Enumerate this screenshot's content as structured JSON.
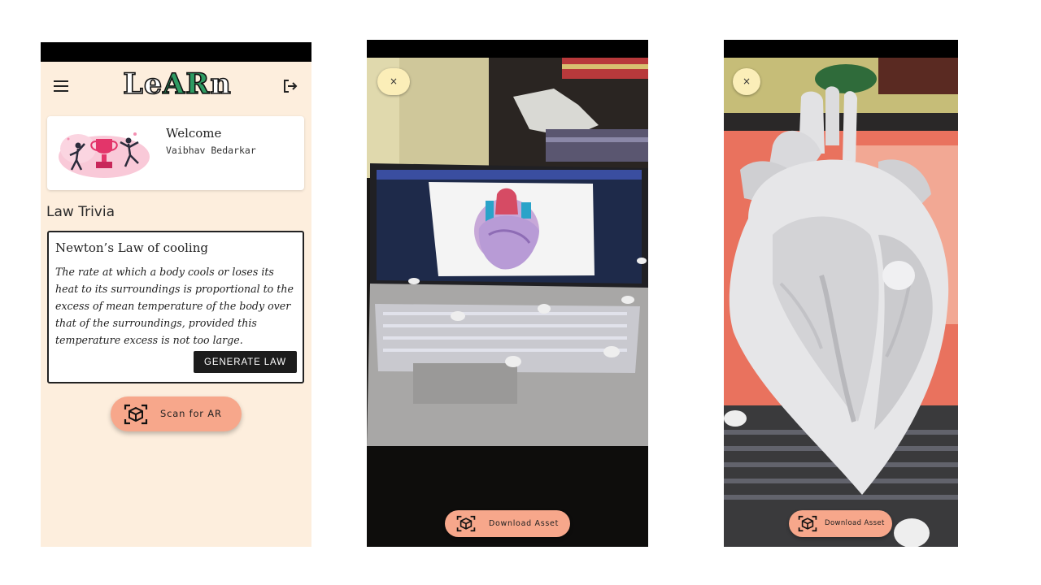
{
  "home": {
    "app_title": "LeARn",
    "logo_part_1": "Le",
    "logo_part_2": "AR",
    "logo_part_3": "n",
    "menu_icon": "hamburger-menu-icon",
    "logout_icon": "logout-icon",
    "welcome": {
      "title": "Welcome",
      "user_name": "Vaibhav Bedarkar",
      "illustration": "trophy-celebration-illustration"
    },
    "section_title": "Law Trivia",
    "trivia": {
      "title": "Newton’s Law of cooling",
      "text": "The rate at which a body cools or loses its heat to its surroundings is proportional to the excess of mean temperature of the body over that of the surroundings, provided this temperature excess is not too large.",
      "button_label": "GENERATE LAW"
    },
    "scan_button": {
      "label": "Scan for AR",
      "icon": "ar-cube-scan-icon"
    },
    "colors": {
      "background": "#fdeedd",
      "accent": "#f7a78b",
      "logo_green": "#2e9b62"
    }
  },
  "ar_view_scanning": {
    "close_label": "×",
    "download_label": "Download Asset",
    "download_icon": "ar-cube-scan-icon",
    "scene": "laptop-screen-showing-heart-diagram"
  },
  "ar_view_model": {
    "close_label": "×",
    "download_label": "Download Asset",
    "download_icon": "ar-cube-scan-icon",
    "scene": "3d-heart-model"
  }
}
